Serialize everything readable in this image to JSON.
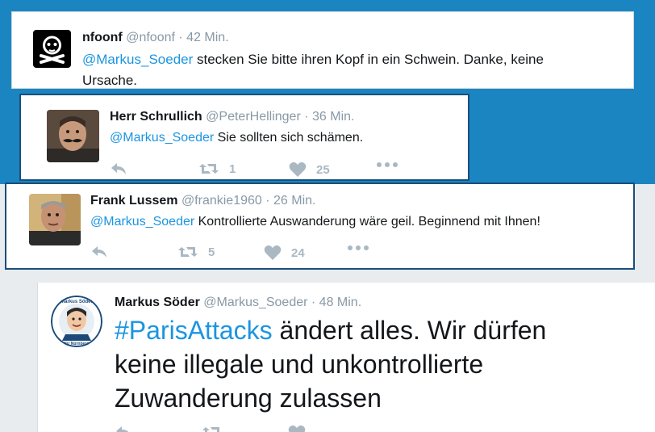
{
  "tweets": [
    {
      "name": "nfoonf",
      "handle": "@nfoonf",
      "time": "· 42 Min.",
      "mention": "@Markus_Soeder",
      "text_line1": " stecken Sie bitte ihren Kopf in ein Schwein. Danke, keine",
      "text_line2": "Ursache."
    },
    {
      "name": "Herr Schrullich",
      "handle": "@PeterHellinger",
      "time": "· 36 Min.",
      "mention": "@Markus_Soeder",
      "text": " Sie sollten sich schämen.",
      "retweets": "1",
      "likes": "25"
    },
    {
      "name": "Frank Lussem",
      "handle": "@frankie1960",
      "time": "· 26 Min.",
      "mention": "@Markus_Soeder",
      "text": " Kontrollierte Auswanderung wäre geil. Beginnend mit Ihnen!",
      "retweets": "5",
      "likes": "24"
    },
    {
      "name": "Markus Söder",
      "handle": "@Markus_Soeder",
      "time": "· 48 Min.",
      "hashtag": "#ParisAttacks",
      "text_line1": " ändert alles. Wir dürfen",
      "text_line2": "keine illegale und unkontrollierte",
      "text_line3": "Zuwanderung zulassen",
      "avatar_text_top": "Markus Söder",
      "avatar_text_bottom": "für Nürnberg"
    }
  ],
  "colors": {
    "accent": "#1b95e0",
    "banner": "#1b85c2",
    "border": "#1a4f7a"
  }
}
